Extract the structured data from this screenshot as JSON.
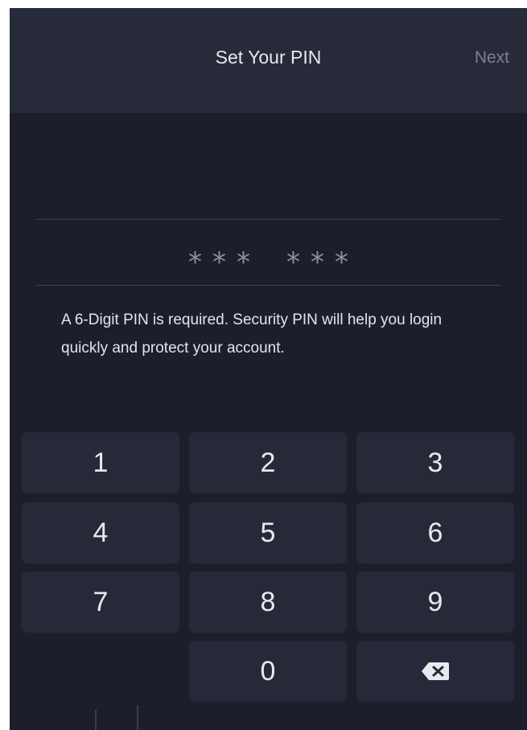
{
  "header": {
    "title": "Set Your PIN",
    "next_label": "Next"
  },
  "pin": {
    "mask_char": "*",
    "length": 6,
    "entered": 6
  },
  "helper_text": "A 6-Digit PIN is required. Security PIN will help you login quickly and protect your account.",
  "keypad": {
    "keys": [
      "1",
      "2",
      "3",
      "4",
      "5",
      "6",
      "7",
      "8",
      "9",
      "0"
    ],
    "backspace_icon": "backspace-icon"
  },
  "colors": {
    "background": "#1c1f2b",
    "header": "#272b39",
    "key": "#262a38",
    "next_disabled": "#7b8090"
  }
}
